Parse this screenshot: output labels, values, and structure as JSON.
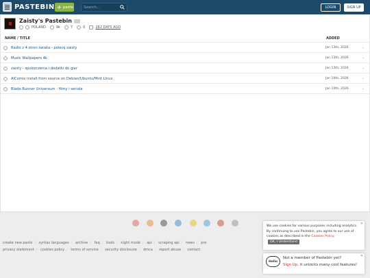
{
  "header": {
    "logo_text": "PASTEBIN",
    "paste_label": "paste",
    "search_placeholder": "Search...",
    "login_label": "LOGIN",
    "signup_label": "SIGN UP",
    "colors": {
      "topbar": "#1d4a6a",
      "paste_button": "#8bb446"
    }
  },
  "profile": {
    "title": "Zaisty's Pastebin",
    "location": "POLAND",
    "views": "9k",
    "rating": "7",
    "stars": "0",
    "date": "282 DAYS AGO"
  },
  "table": {
    "col_name": "NAME / TITLE",
    "col_added": "ADDED",
    "rows": [
      {
        "title": "Radio z 4 stron świata - polecę zaisty",
        "added": "Jan 13th, 2026",
        "extra": "-"
      },
      {
        "title": "Music Wallpapers 4k",
        "added": "Jan 13th, 2026",
        "extra": "-"
      },
      {
        "title": "zaisty - spolszczenia i dodatki do gier",
        "added": "Jan 13th, 2026",
        "extra": "-"
      },
      {
        "title": "AlComix install from source on Debian/Ubuntu/Mint Linux",
        "added": "Jan 10th, 2026",
        "extra": "-"
      },
      {
        "title": "Blade Runner Universum - filmy i seriale",
        "added": "Jan 10th, 2026",
        "extra": "-"
      }
    ]
  },
  "footer": {
    "row1": [
      "create new paste",
      "syntax languages",
      "archive",
      "faq",
      "tools",
      "night mode",
      "api",
      "scraping api",
      "news",
      "pro"
    ],
    "row2": [
      "privacy statement",
      "cookies policy",
      "terms of service",
      "security disclosure",
      "dmca",
      "report abuse",
      "contact"
    ]
  },
  "cookie": {
    "text_a": "We use cookies for various purposes including analytics. By continuing to use Pastebin, you agree to our use of cookies as described in the",
    "policy": "Cookies Policy.",
    "ok": "OK, I Understand"
  },
  "member": {
    "badge": "Hello",
    "line1": "Not a member of Pastebin yet?",
    "signup": "Sign Up",
    "line2_rest": ", it unlocks many cool features!"
  }
}
